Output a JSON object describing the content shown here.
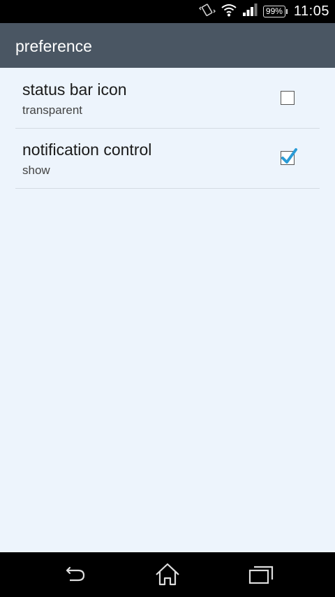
{
  "status_bar": {
    "battery": "99%",
    "time": "11:05",
    "icons": [
      "vibrate-icon",
      "wifi-icon",
      "signal-icon",
      "battery-icon"
    ]
  },
  "action_bar": {
    "title": "preference"
  },
  "preferences": [
    {
      "title": "status bar icon",
      "summary": "transparent",
      "checked": false
    },
    {
      "title": "notification control",
      "summary": "show",
      "checked": true
    }
  ],
  "nav_bar": {
    "buttons": [
      "back-icon",
      "home-icon",
      "recents-icon"
    ]
  },
  "colors": {
    "action_bar": "#4a5663",
    "background": "#edf4fc",
    "check_accent": "#2a9bd6"
  }
}
